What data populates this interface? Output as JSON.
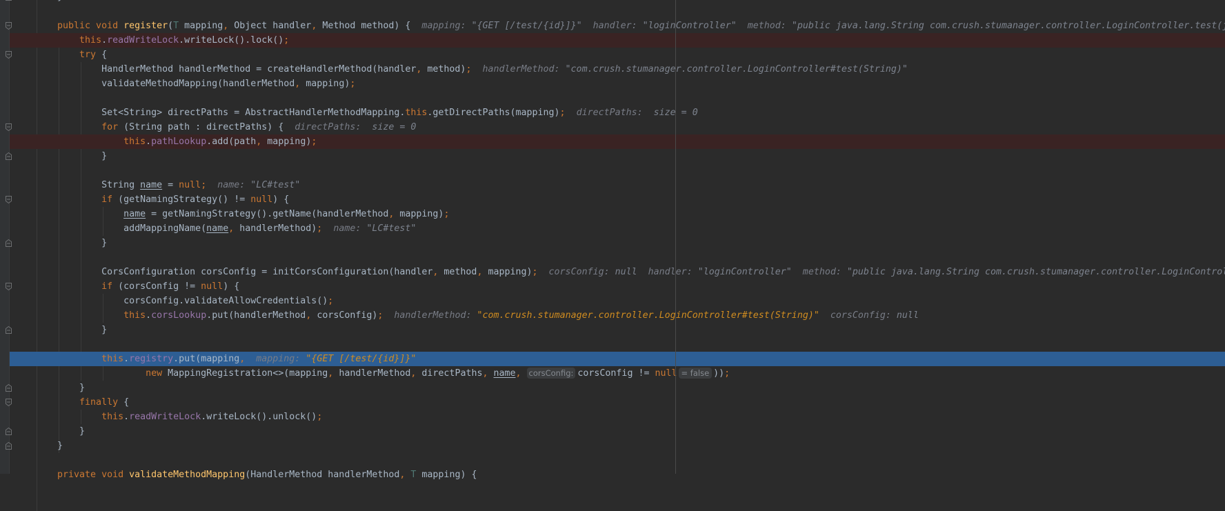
{
  "editor": {
    "colors": {
      "background": "#2b2b2b",
      "keyword": "#cc7832",
      "field": "#9876aa",
      "method": "#ffc66d",
      "text": "#a9b7c6",
      "breakpoint_line": "#3a2323",
      "execution_line": "#2d5e94",
      "hint": "#787c86",
      "changed_hint": "#d08c20"
    },
    "lines": [
      {
        "fold": "end",
        "tokens": [
          [
            "    }",
            "t"
          ]
        ]
      },
      {
        "tokens": []
      },
      {
        "fold": "start",
        "tokens": [
          [
            "    public void ",
            "k"
          ],
          [
            "register",
            "m"
          ],
          [
            "(",
            "t"
          ],
          [
            "T",
            "tp"
          ],
          [
            " mapping",
            "t"
          ],
          [
            ", ",
            "k"
          ],
          [
            "Object handler",
            "t"
          ],
          [
            ", ",
            "k"
          ],
          [
            "Method method) {",
            "t"
          ],
          [
            "  mapping: ",
            "h"
          ],
          [
            "\"{GET [/test/{id}]}\"",
            "hv"
          ],
          [
            "  handler: ",
            "h"
          ],
          [
            "\"loginController\"",
            "hv"
          ],
          [
            "  method: ",
            "h"
          ],
          [
            "\"public java.lang.String com.crush.stumanager.controller.LoginController.test(j",
            "hv"
          ]
        ]
      },
      {
        "state": "breakpoint",
        "tokens": [
          [
            "        ",
            "t"
          ],
          [
            "this",
            "k"
          ],
          [
            ".",
            "t"
          ],
          [
            "readWriteLock",
            "f"
          ],
          [
            ".writeLock().lock()",
            "t"
          ],
          [
            ";",
            "k"
          ]
        ]
      },
      {
        "fold": "start",
        "tokens": [
          [
            "        try",
            "k"
          ],
          [
            " {",
            "t"
          ]
        ]
      },
      {
        "tokens": [
          [
            "            HandlerMethod handlerMethod = createHandlerMethod(handler",
            "t"
          ],
          [
            ", ",
            "k"
          ],
          [
            "method)",
            "t"
          ],
          [
            ";",
            "k"
          ],
          [
            "  handlerMethod: ",
            "h"
          ],
          [
            "\"com.crush.stumanager.controller.LoginController#test(String)\"",
            "hv"
          ]
        ]
      },
      {
        "tokens": [
          [
            "            validateMethodMapping(handlerMethod",
            "t"
          ],
          [
            ", ",
            "k"
          ],
          [
            "mapping)",
            "t"
          ],
          [
            ";",
            "k"
          ]
        ]
      },
      {
        "tokens": []
      },
      {
        "tokens": [
          [
            "            Set<String> directPaths = AbstractHandlerMethodMapping.",
            "t"
          ],
          [
            "this",
            "k"
          ],
          [
            ".getDirectPaths(mapping)",
            "t"
          ],
          [
            ";",
            "k"
          ],
          [
            "  directPaths:  ",
            "h"
          ],
          [
            "size = 0",
            "hv"
          ]
        ]
      },
      {
        "fold": "start",
        "tokens": [
          [
            "            for",
            "k"
          ],
          [
            " (String path : directPaths) {",
            "t"
          ],
          [
            "  directPaths:  ",
            "h"
          ],
          [
            "size = 0",
            "hv"
          ]
        ]
      },
      {
        "state": "breakpoint",
        "tokens": [
          [
            "                ",
            "t"
          ],
          [
            "this",
            "k"
          ],
          [
            ".",
            "t"
          ],
          [
            "pathLookup",
            "f"
          ],
          [
            ".add(path",
            "t"
          ],
          [
            ", ",
            "k"
          ],
          [
            "mapping)",
            "t"
          ],
          [
            ";",
            "k"
          ]
        ]
      },
      {
        "fold": "end",
        "tokens": [
          [
            "            }",
            "t"
          ]
        ]
      },
      {
        "tokens": []
      },
      {
        "tokens": [
          [
            "            String ",
            "t"
          ],
          [
            "name",
            "u"
          ],
          [
            " = ",
            "t"
          ],
          [
            "null",
            "k"
          ],
          [
            ";",
            "k"
          ],
          [
            "  name: ",
            "h"
          ],
          [
            "\"LC#test\"",
            "hv"
          ]
        ]
      },
      {
        "fold": "start",
        "tokens": [
          [
            "            if",
            "k"
          ],
          [
            " (getNamingStrategy() != ",
            "t"
          ],
          [
            "null",
            "k"
          ],
          [
            ") {",
            "t"
          ]
        ]
      },
      {
        "tokens": [
          [
            "                ",
            "t"
          ],
          [
            "name",
            "u"
          ],
          [
            " = getNamingStrategy().getName(handlerMethod",
            "t"
          ],
          [
            ", ",
            "k"
          ],
          [
            "mapping)",
            "t"
          ],
          [
            ";",
            "k"
          ]
        ]
      },
      {
        "tokens": [
          [
            "                addMappingName(",
            "t"
          ],
          [
            "name",
            "u"
          ],
          [
            ", ",
            "k"
          ],
          [
            "handlerMethod)",
            "t"
          ],
          [
            ";",
            "k"
          ],
          [
            "  name: ",
            "h"
          ],
          [
            "\"LC#test\"",
            "hv"
          ]
        ]
      },
      {
        "fold": "end",
        "tokens": [
          [
            "            }",
            "t"
          ]
        ]
      },
      {
        "tokens": []
      },
      {
        "tokens": [
          [
            "            CorsConfiguration corsConfig = initCorsConfiguration(handler",
            "t"
          ],
          [
            ", ",
            "k"
          ],
          [
            "method",
            "t"
          ],
          [
            ", ",
            "k"
          ],
          [
            "mapping)",
            "t"
          ],
          [
            ";",
            "k"
          ],
          [
            "  corsConfig: ",
            "h"
          ],
          [
            "null",
            "hv"
          ],
          [
            "  handler: ",
            "h"
          ],
          [
            "\"loginController\"",
            "hv"
          ],
          [
            "  method: ",
            "h"
          ],
          [
            "\"public java.lang.String com.crush.stumanager.controller.LoginControl",
            "hv"
          ]
        ]
      },
      {
        "fold": "start",
        "tokens": [
          [
            "            if",
            "k"
          ],
          [
            " (corsConfig != ",
            "t"
          ],
          [
            "null",
            "k"
          ],
          [
            ") {",
            "t"
          ]
        ]
      },
      {
        "tokens": [
          [
            "                corsConfig.validateAllowCredentials()",
            "t"
          ],
          [
            ";",
            "k"
          ]
        ]
      },
      {
        "tokens": [
          [
            "                ",
            "t"
          ],
          [
            "this",
            "k"
          ],
          [
            ".",
            "t"
          ],
          [
            "corsLookup",
            "f"
          ],
          [
            ".put(handlerMethod",
            "t"
          ],
          [
            ", ",
            "k"
          ],
          [
            "corsConfig)",
            "t"
          ],
          [
            ";",
            "k"
          ],
          [
            "  handlerMethod: ",
            "h"
          ],
          [
            "\"com.crush.stumanager.controller.LoginController#test(String)\"",
            "ho"
          ],
          [
            "  corsConfig: ",
            "h"
          ],
          [
            "null",
            "hv"
          ]
        ]
      },
      {
        "fold": "end",
        "tokens": [
          [
            "            }",
            "t"
          ]
        ]
      },
      {
        "tokens": []
      },
      {
        "state": "execution-point",
        "tokens": [
          [
            "            ",
            "t"
          ],
          [
            "this",
            "k"
          ],
          [
            ".",
            "t"
          ],
          [
            "registry",
            "f"
          ],
          [
            ".put(mapping",
            "t"
          ],
          [
            ", ",
            "k"
          ],
          [
            " mapping: ",
            "h"
          ],
          [
            "\"{GET [/test/{id}]}\"",
            "ho"
          ]
        ]
      },
      {
        "tokens": [
          [
            "                    new",
            "k"
          ],
          [
            " MappingRegistration<>(mapping",
            "t"
          ],
          [
            ", ",
            "k"
          ],
          [
            "handlerMethod",
            "t"
          ],
          [
            ", ",
            "k"
          ],
          [
            "directPaths",
            "t"
          ],
          [
            ", ",
            "k"
          ],
          [
            "name",
            "u"
          ],
          [
            ", ",
            "k"
          ],
          [
            "corsConfig:",
            "pb"
          ],
          [
            "corsConfig != ",
            "t"
          ],
          [
            "null",
            "k"
          ],
          [
            "= false",
            "vb"
          ],
          [
            "))",
            "t"
          ],
          [
            ";",
            "k"
          ]
        ]
      },
      {
        "fold": "end",
        "tokens": [
          [
            "        }",
            "t"
          ]
        ]
      },
      {
        "fold": "start",
        "tokens": [
          [
            "        finally",
            "k"
          ],
          [
            " {",
            "t"
          ]
        ]
      },
      {
        "tokens": [
          [
            "            ",
            "t"
          ],
          [
            "this",
            "k"
          ],
          [
            ".",
            "t"
          ],
          [
            "readWriteLock",
            "f"
          ],
          [
            ".writeLock().unlock()",
            "t"
          ],
          [
            ";",
            "k"
          ]
        ]
      },
      {
        "fold": "end",
        "tokens": [
          [
            "        }",
            "t"
          ]
        ]
      },
      {
        "fold": "end",
        "tokens": [
          [
            "    }",
            "t"
          ]
        ]
      },
      {
        "tokens": []
      },
      {
        "tokens": [
          [
            "    private void ",
            "k"
          ],
          [
            "validateMethodMapping",
            "m"
          ],
          [
            "(HandlerMethod handlerMethod",
            "t"
          ],
          [
            ", ",
            "k"
          ],
          [
            "T",
            "tp"
          ],
          [
            " mapping) {",
            "t"
          ]
        ]
      }
    ]
  }
}
